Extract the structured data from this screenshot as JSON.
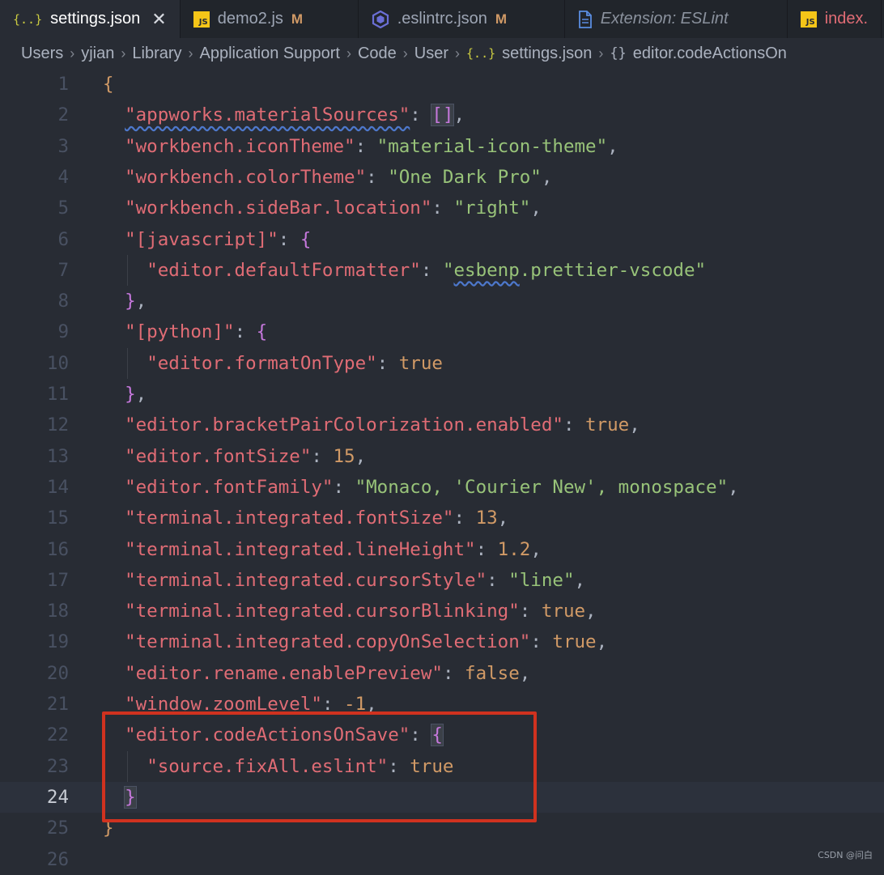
{
  "tabs": [
    {
      "label": "settings.json",
      "icon": "json-icon",
      "icon_glyph": "{..}",
      "active": true,
      "close": "✕"
    },
    {
      "label": "demo2.js",
      "icon": "js-icon",
      "icon_glyph": "JS",
      "modified": "M"
    },
    {
      "label": ".eslintrc.json",
      "icon": "eslint-icon",
      "modified": "M"
    },
    {
      "label": "Extension: ESLint",
      "icon": "file-icon"
    },
    {
      "label": "index.",
      "icon": "js-icon",
      "icon_glyph": "JS"
    }
  ],
  "breadcrumb": {
    "items": [
      "Users",
      "yjian",
      "Library",
      "Application Support",
      "Code",
      "User"
    ],
    "file": "settings.json",
    "symbol": "editor.codeActionsOn",
    "file_icon": "{..}",
    "symbol_icon": "{}",
    "separator": "›"
  },
  "editor": {
    "current_line": 24,
    "line_numbers": [
      "1",
      "2",
      "3",
      "4",
      "5",
      "6",
      "7",
      "8",
      "9",
      "10",
      "11",
      "12",
      "13",
      "14",
      "15",
      "16",
      "17",
      "18",
      "19",
      "20",
      "21",
      "22",
      "23",
      "24",
      "25",
      "26"
    ]
  },
  "settings": {
    "materialSources": {
      "key": "\"appworks.materialSources\"",
      "value": "[]"
    },
    "iconTheme": {
      "key": "\"workbench.iconTheme\"",
      "value": "\"material-icon-theme\""
    },
    "colorTheme": {
      "key": "\"workbench.colorTheme\"",
      "value": "\"One Dark Pro\""
    },
    "sideBarLocation": {
      "key": "\"workbench.sideBar.location\"",
      "value": "\"right\""
    },
    "javascript": {
      "key": "\"[javascript]\""
    },
    "defaultFormatter": {
      "key": "\"editor.defaultFormatter\"",
      "value_quote": "\"",
      "value_a": "esbenp",
      "value_b": ".prettier-vscode\""
    },
    "python": {
      "key": "\"[python]\""
    },
    "formatOnType": {
      "key": "\"editor.formatOnType\"",
      "value": "true"
    },
    "bracketPairColorization": {
      "key": "\"editor.bracketPairColorization.enabled\"",
      "value": "true"
    },
    "fontSize": {
      "key": "\"editor.fontSize\"",
      "value": "15"
    },
    "fontFamily": {
      "key": "\"editor.fontFamily\"",
      "value": "\"Monaco, 'Courier New', monospace\""
    },
    "termFontSize": {
      "key": "\"terminal.integrated.fontSize\"",
      "value": "13"
    },
    "termLineHeight": {
      "key": "\"terminal.integrated.lineHeight\"",
      "value": "1.2"
    },
    "termCursorStyle": {
      "key": "\"terminal.integrated.cursorStyle\"",
      "value": "\"line\""
    },
    "termCursorBlinking": {
      "key": "\"terminal.integrated.cursorBlinking\"",
      "value": "true"
    },
    "termCopyOnSelection": {
      "key": "\"terminal.integrated.copyOnSelection\"",
      "value": "true"
    },
    "renamePreview": {
      "key": "\"editor.rename.enablePreview\"",
      "value": "false"
    },
    "zoomLevel": {
      "key": "\"window.zoomLevel\"",
      "value": "-1"
    },
    "codeActionsOnSave": {
      "key": "\"editor.codeActionsOnSave\""
    },
    "fixAllEslint": {
      "key": "\"source.fixAll.eslint\"",
      "value": "true"
    }
  },
  "watermark": "CSDN @问白",
  "colors": {
    "accent_box": "#d0321f",
    "background": "#282c34",
    "key": "#e06c75",
    "string": "#98c379",
    "number": "#d19a66"
  }
}
